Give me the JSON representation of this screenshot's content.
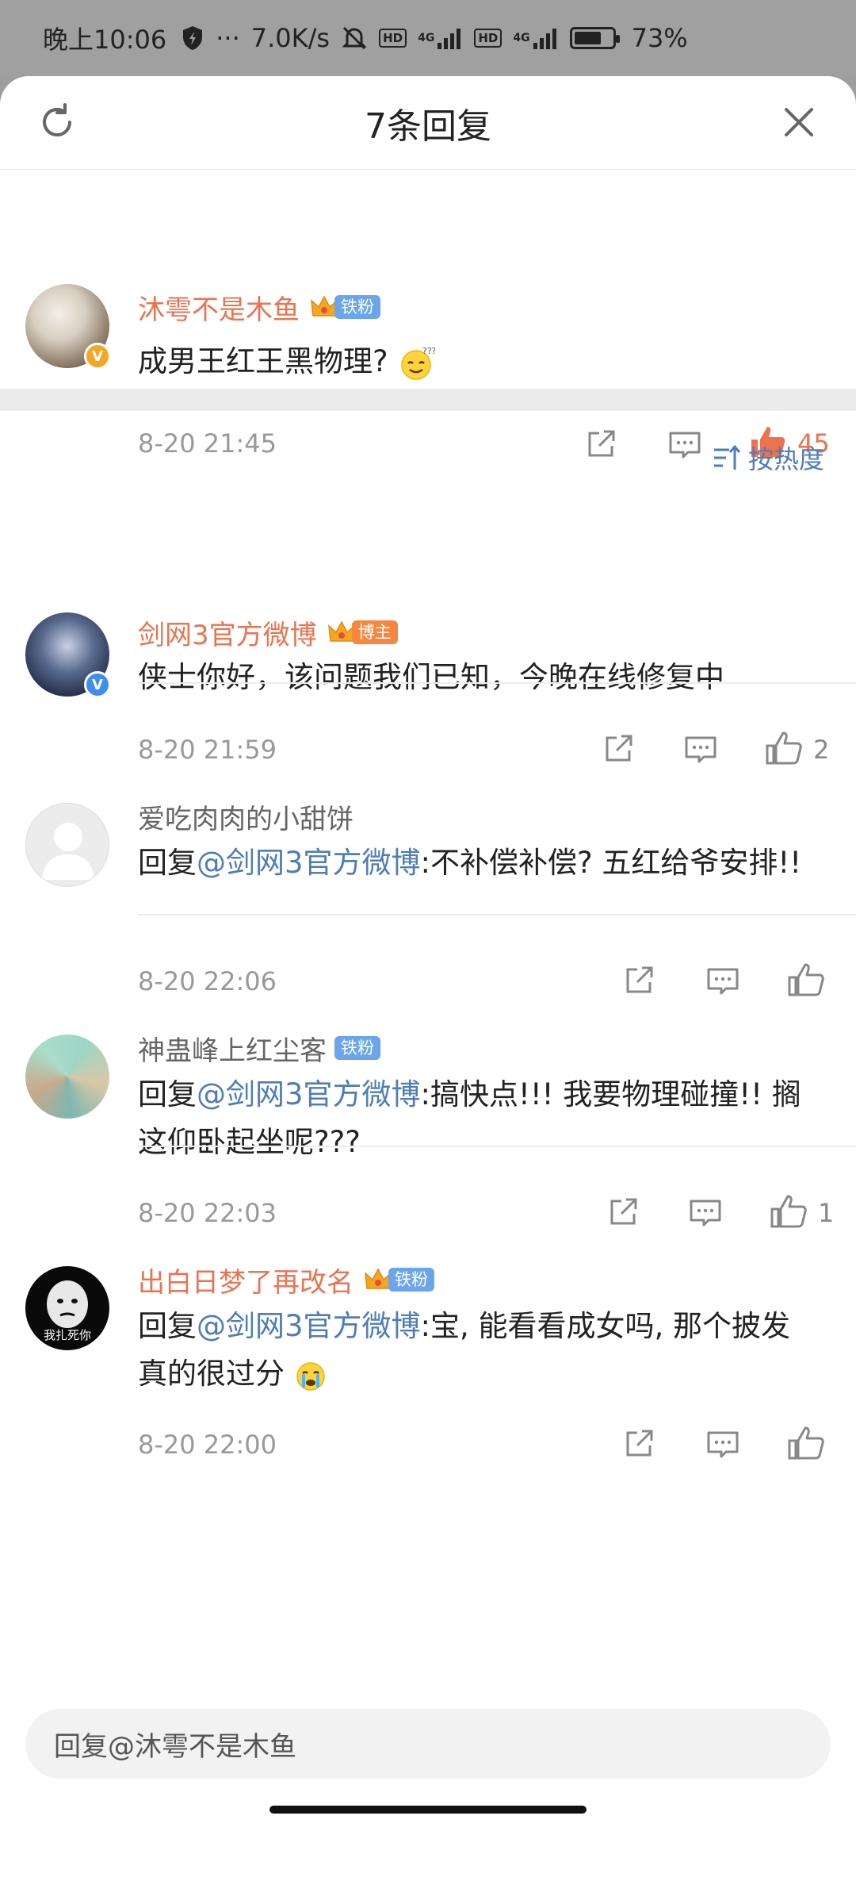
{
  "status_bar": {
    "time": "晚上10:06",
    "more": "···",
    "speed": "7.0K/s",
    "hd": "HD",
    "net": "4G",
    "battery": "73%",
    "battery_level": 0.73
  },
  "sheet": {
    "title": "7条回复"
  },
  "root_comment": {
    "username": "沐雩不是木鱼",
    "badge": "铁粉",
    "text": "成男王红王黑物理?",
    "time": "8-20 21:45",
    "likes": "45"
  },
  "sort": {
    "label": "按热度"
  },
  "replies": [
    {
      "username": "剑网3官方微博",
      "badge": "博主",
      "text": "侠士你好，该问题我们已知，今晚在线修复中",
      "time": "8-20 21:59",
      "likes": "2"
    },
    {
      "username": "爱吃肉肉的小甜饼",
      "reply_prefix": "回复",
      "mention": "@剑网3官方微博",
      "text": ":不补偿补偿? 五红给爷安排!!",
      "time": "8-20 22:06",
      "likes": ""
    },
    {
      "username": "神蛊峰上红尘客",
      "badge": "铁粉",
      "reply_prefix": "回复",
      "mention": "@剑网3官方微博",
      "text": ":搞快点!!! 我要物理碰撞!! 搁这仰卧起坐呢???",
      "time": "8-20 22:03",
      "likes": "1"
    },
    {
      "username": "出白日梦了再改名",
      "badge": "铁粉",
      "reply_prefix": "回复",
      "mention": "@剑网3官方微博",
      "text": ":宝, 能看看成女吗, 那个披发真的很过分",
      "time": "8-20 22:00",
      "likes": "",
      "avatar_caption": "我扎死你"
    }
  ],
  "reply_input": {
    "placeholder": "回复@沐雩不是木鱼"
  },
  "colors": {
    "accent_orange": "#eb7350",
    "link_blue": "#4f7db8",
    "badge_blue": "#6ba5ec",
    "badge_orange": "#f5873e"
  }
}
